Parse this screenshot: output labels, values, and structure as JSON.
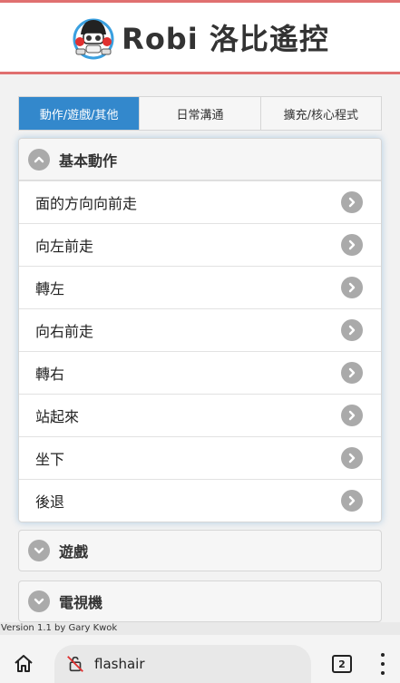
{
  "header": {
    "title": "Robi 洛比遙控",
    "logo_icon": "robi-robot-logo"
  },
  "tabs": [
    {
      "label": "動作/遊戲/其他",
      "active": true
    },
    {
      "label": "日常溝通",
      "active": false
    },
    {
      "label": "擴充/核心程式",
      "active": false
    }
  ],
  "sections": {
    "basic": {
      "title": "基本動作",
      "expanded": true,
      "items": [
        {
          "label": "面的方向向前走"
        },
        {
          "label": "向左前走"
        },
        {
          "label": "轉左"
        },
        {
          "label": "向右前走"
        },
        {
          "label": "轉右"
        },
        {
          "label": "站起來"
        },
        {
          "label": "坐下"
        },
        {
          "label": "後退"
        }
      ]
    },
    "games": {
      "title": "遊戲",
      "expanded": false
    },
    "tv": {
      "title": "電視機",
      "expanded": false
    }
  },
  "footer": {
    "version": "Version 1.1 by Gary Kwok"
  },
  "browser": {
    "url": "flashair",
    "tab_count": "2"
  },
  "colors": {
    "accent": "#3388cc",
    "header_line": "#e07070",
    "icon_gray": "#aaaaaa"
  }
}
